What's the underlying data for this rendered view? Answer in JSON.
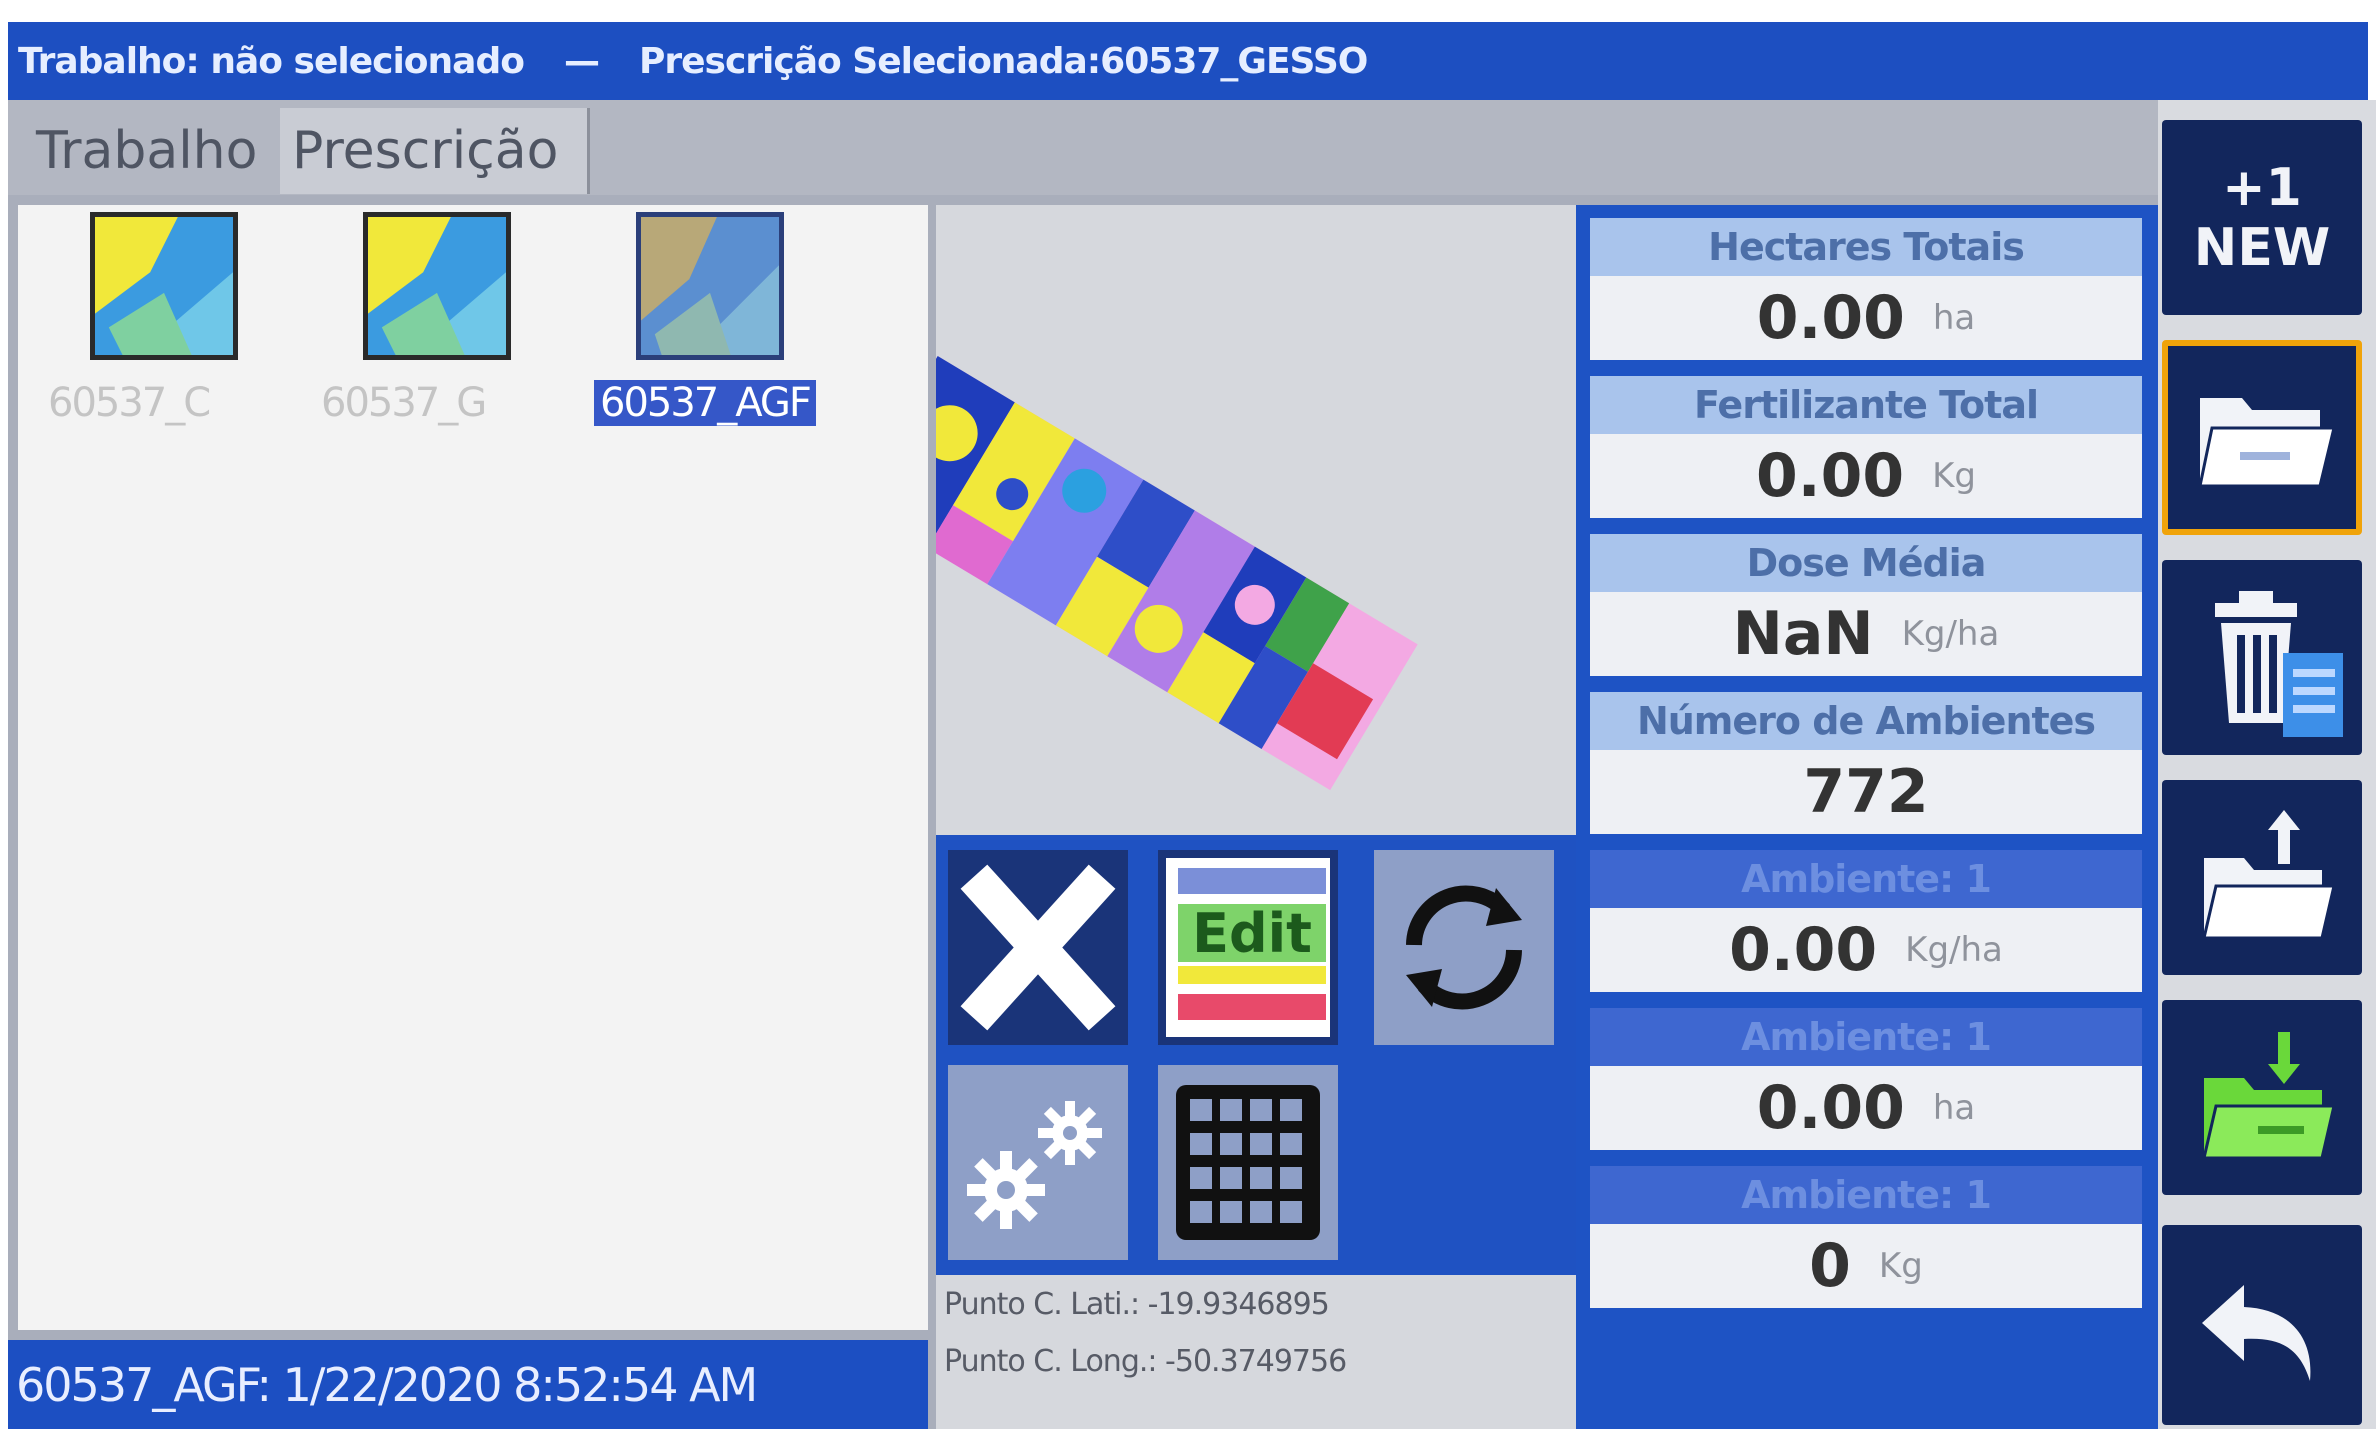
{
  "titlebar": {
    "job": "Trabalho: não selecionado",
    "separator": "—",
    "prescription": "Prescrição Selecionada:60537_GESSO"
  },
  "tabs": [
    "Trabalho",
    "Prescrição"
  ],
  "files": [
    {
      "name": "60537_C",
      "selected": false
    },
    {
      "name": "60537_G",
      "selected": false
    },
    {
      "name": "60537_AGF",
      "selected": true
    }
  ],
  "status": "60537_AGF: 1/22/2020 8:52:54 AM",
  "controls": {
    "edit_label": "Edit"
  },
  "coords": {
    "lat": "Punto C. Lati.: -19.9346895",
    "long": "Punto C. Long.: -50.3749756"
  },
  "stats": [
    {
      "label": "Hectares Totais",
      "value": "0.00",
      "unit": "ha"
    },
    {
      "label": "Fertilizante Total",
      "value": "0.00",
      "unit": "Kg"
    },
    {
      "label": "Dose Média",
      "value": "NaN",
      "unit": "Kg/ha"
    },
    {
      "label": "Número de Ambientes",
      "value": "772",
      "unit": ""
    },
    {
      "label": "Ambiente: 1",
      "value": "0.00",
      "unit": "Kg/ha"
    },
    {
      "label": "Ambiente: 1",
      "value": "0.00",
      "unit": "ha"
    },
    {
      "label": "Ambiente: 1",
      "value": "0",
      "unit": "Kg"
    }
  ],
  "toolbar": {
    "new_plus": "+1",
    "new_label": "NEW",
    "icons": [
      "new-icon",
      "open-folder-icon",
      "delete-icon",
      "export-folder-icon",
      "import-folder-icon",
      "back-icon"
    ]
  },
  "colors": {
    "titlebar": "#1d4fc1",
    "panel_blue": "#1e53c4",
    "toolbar_button": "#12265c",
    "highlight": "#f0a30a",
    "selection": "#3557c8"
  }
}
